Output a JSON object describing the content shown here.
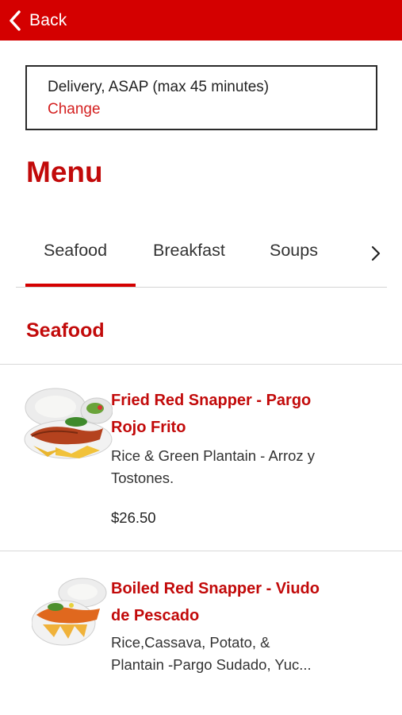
{
  "topbar": {
    "back_label": "Back",
    "color": "#d40000"
  },
  "delivery": {
    "text": "Delivery, ASAP (max 45 minutes)",
    "change_label": "Change"
  },
  "menu_title": "Menu",
  "tabs": [
    {
      "label": "Seafood",
      "active": true
    },
    {
      "label": "Breakfast",
      "active": false
    },
    {
      "label": "Soups",
      "active": false
    }
  ],
  "section_title": "Seafood",
  "items": [
    {
      "name_line1": "Fried Red Snapper - Pargo",
      "name_line2": "Rojo Frito",
      "desc_line1": "Rice & Green Plantain - Arroz y",
      "desc_line2": "Tostones.",
      "price": "$26.50"
    },
    {
      "name_line1": "Boiled Red Snapper - Viudo",
      "name_line2": "de Pescado",
      "desc_line1": "Rice,Cassava, Potato, &",
      "desc_line2": "Plantain -Pargo Sudado, Yuc..."
    }
  ],
  "accent_color": "#c20a0a"
}
